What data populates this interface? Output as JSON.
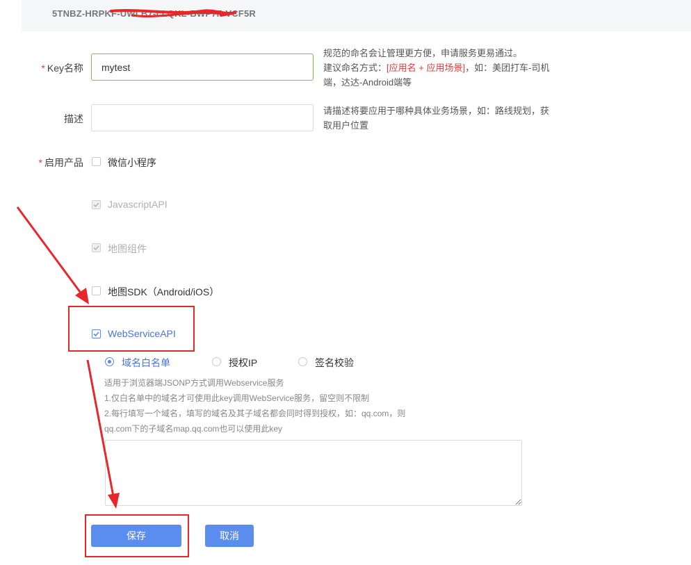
{
  "key_bar": {
    "text": "5TNBZ-HRPKF-UWLB7-LLQKL-BWP7F-VCF5R"
  },
  "form": {
    "key_name": {
      "label": "Key名称",
      "required_mark": "*",
      "value": "mytest",
      "hint": {
        "line1": "规范的命名会让管理更方便，申请服务更易通过。",
        "line2_prefix": "建议命名方式：",
        "line2_red": "[应用名 + 应用场景]",
        "line2_suffix": "，如：美团打车-司机",
        "line3": "端，达达-Android端等"
      }
    },
    "description": {
      "label": "描述",
      "value": "",
      "hint": {
        "line1": "请描述将要应用于哪种具体业务场景，如：路线规划，获",
        "line2": "取用户位置"
      }
    },
    "products": {
      "label": "启用产品",
      "required_mark": "*",
      "items": [
        {
          "label": "微信小程序",
          "checked": false,
          "disabled": false
        },
        {
          "label": "JavascriptAPI",
          "checked": true,
          "disabled": true
        },
        {
          "label": "地图组件",
          "checked": true,
          "disabled": true
        },
        {
          "label": "地图SDK（Android/iOS）",
          "checked": false,
          "disabled": false
        },
        {
          "label": "WebServiceAPI",
          "checked": true,
          "disabled": false
        }
      ]
    },
    "webservice": {
      "radios": [
        {
          "label": "域名白名单",
          "selected": true
        },
        {
          "label": "授权IP",
          "selected": false
        },
        {
          "label": "签名校验",
          "selected": false
        }
      ],
      "desc": [
        "适用于浏览器端JSONP方式调用Webservice服务",
        "1.仅白名单中的域名才可使用此key调用WebService服务，留空则不限制",
        "2.每行填写一个域名，填写的域名及其子域名都会同时得到授权，如：qq.com，则",
        "qq.com下的子域名map.qq.com也可以使用此key"
      ],
      "whitelist_value": ""
    },
    "buttons": {
      "save": "保存",
      "cancel": "取消"
    }
  },
  "colors": {
    "accent": "#5b8def",
    "annotation": "#e8272b",
    "input_active": "#7cc04e"
  }
}
